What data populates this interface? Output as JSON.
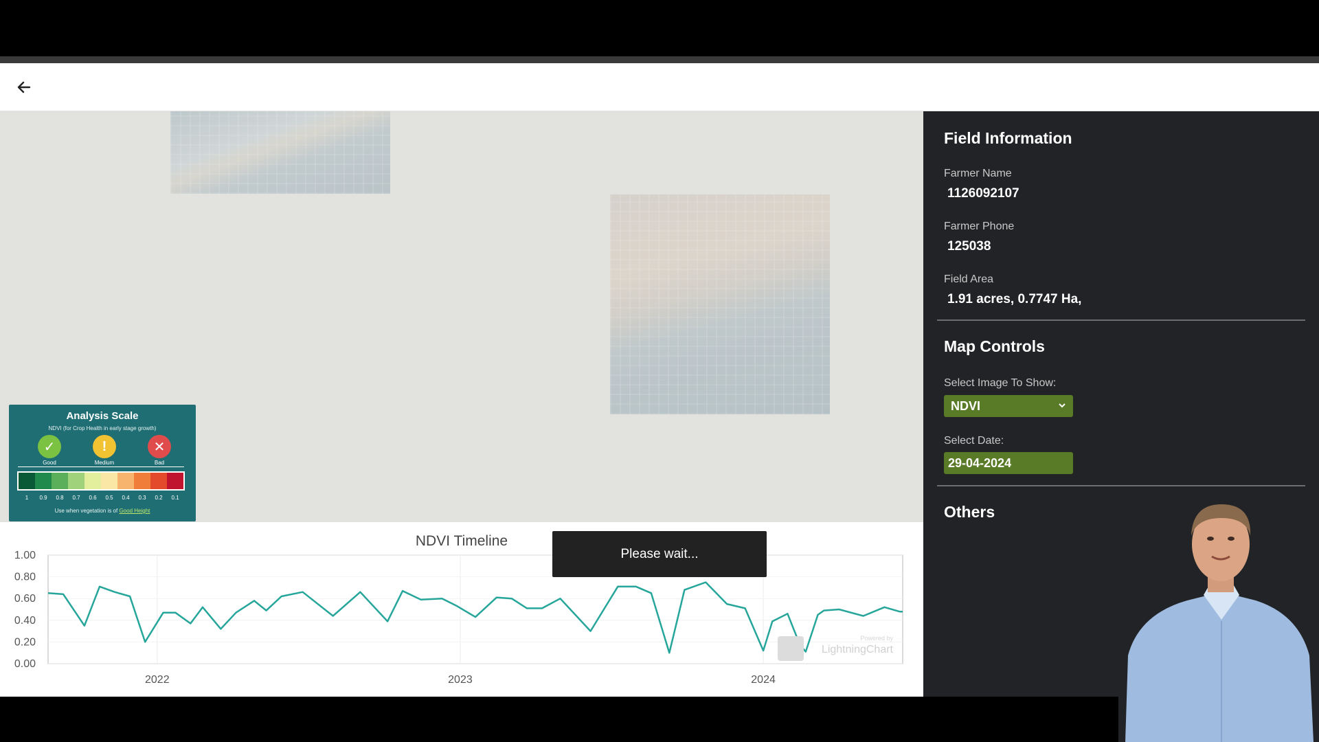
{
  "header": {
    "back_icon": "arrow-left-icon"
  },
  "analysis_scale": {
    "title": "Analysis Scale",
    "subtitle": "NDVI (for Crop Health in early stage growth)",
    "good_label": "Good",
    "medium_label": "Medium",
    "bad_label": "Bad",
    "ticks": [
      "1",
      "0.9",
      "0.8",
      "0.7",
      "0.6",
      "0.5",
      "0.4",
      "0.3",
      "0.2",
      "0.1"
    ],
    "colors": [
      "#0a5a37",
      "#1f8a4c",
      "#5bae5a",
      "#9fd27a",
      "#e3ef9c",
      "#fbe7a5",
      "#f6b46e",
      "#f07e3a",
      "#e34a2b",
      "#c0142e"
    ],
    "footer_prefix": "Use when vegetation is of",
    "footer_link": "Good Height"
  },
  "chart": {
    "title": "NDVI Timeline",
    "toast": "Please wait...",
    "watermark": "LightningChart",
    "watermark_prefix": "Powered by"
  },
  "chart_data": {
    "type": "line",
    "title": "NDVI Timeline",
    "xlabel": "",
    "ylabel": "",
    "ylim": [
      0,
      1
    ],
    "yticks": [
      "1.00",
      "0.80",
      "0.60",
      "0.40",
      "0.20",
      "0.00"
    ],
    "xticks": [
      {
        "label": "2022",
        "x": 2022.0
      },
      {
        "label": "2023",
        "x": 2023.0
      },
      {
        "label": "2024",
        "x": 2024.0
      }
    ],
    "xlim": [
      2021.64,
      2024.46
    ],
    "series": [
      {
        "color": "#26a69a",
        "x": [
          2021.64,
          2021.69,
          2021.76,
          2021.81,
          2021.86,
          2021.91,
          2021.96,
          2022.02,
          2022.06,
          2022.11,
          2022.15,
          2022.21,
          2022.26,
          2022.32,
          2022.36,
          2022.41,
          2022.48,
          2022.58,
          2022.67,
          2022.76,
          2022.81,
          2022.87,
          2022.94,
          2022.99,
          2023.05,
          2023.12,
          2023.17,
          2023.22,
          2023.27,
          2023.33,
          2023.43,
          2023.52,
          2023.58,
          2023.63,
          2023.69,
          2023.74,
          2023.81,
          2023.88,
          2023.94,
          2024.0,
          2024.03,
          2024.08,
          2024.12,
          2024.14,
          2024.18,
          2024.2,
          2024.25,
          2024.33,
          2024.4,
          2024.45,
          2024.46
        ],
        "y": [
          0.65,
          0.64,
          0.35,
          0.71,
          0.66,
          0.62,
          0.2,
          0.47,
          0.47,
          0.37,
          0.52,
          0.32,
          0.47,
          0.58,
          0.49,
          0.62,
          0.66,
          0.44,
          0.66,
          0.39,
          0.67,
          0.59,
          0.6,
          0.53,
          0.43,
          0.61,
          0.6,
          0.51,
          0.51,
          0.6,
          0.3,
          0.71,
          0.71,
          0.65,
          0.1,
          0.68,
          0.75,
          0.55,
          0.51,
          0.12,
          0.39,
          0.46,
          0.18,
          0.11,
          0.45,
          0.49,
          0.5,
          0.44,
          0.52,
          0.48,
          0.48
        ]
      }
    ]
  },
  "field_info": {
    "title": "Field Information",
    "farmer_name_label": "Farmer Name",
    "farmer_name": "1126092107",
    "farmer_phone_label": "Farmer Phone",
    "farmer_phone": "125038",
    "field_area_label": "Field Area",
    "field_area": "1.91 acres, 0.7747 Ha,"
  },
  "map_controls": {
    "title": "Map Controls",
    "image_label": "Select Image To Show:",
    "image_value": "NDVI",
    "date_label": "Select Date:",
    "date_value": "29-04-2024"
  },
  "others": {
    "title": "Others"
  }
}
